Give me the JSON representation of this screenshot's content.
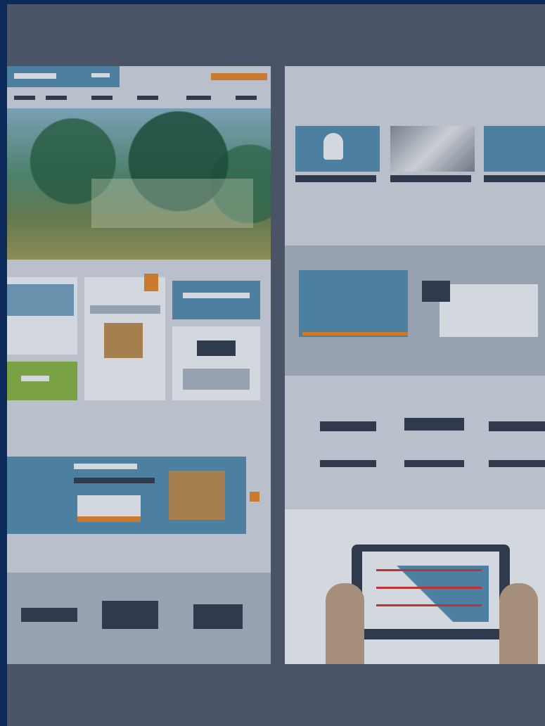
{
  "screen": {
    "title": "",
    "colors": {
      "background": "#0b2a5a",
      "frame": "#4a5466",
      "panel": "#b9c0cb",
      "accent_teal": "#4c7fa0",
      "accent_orange": "#c97a2c",
      "accent_green": "#7aa245"
    },
    "icons": [
      "cardboard-box-icon",
      "printer-icon",
      "lightbulb-icon",
      "calendar-icon",
      "tablet-chart-icon"
    ]
  }
}
